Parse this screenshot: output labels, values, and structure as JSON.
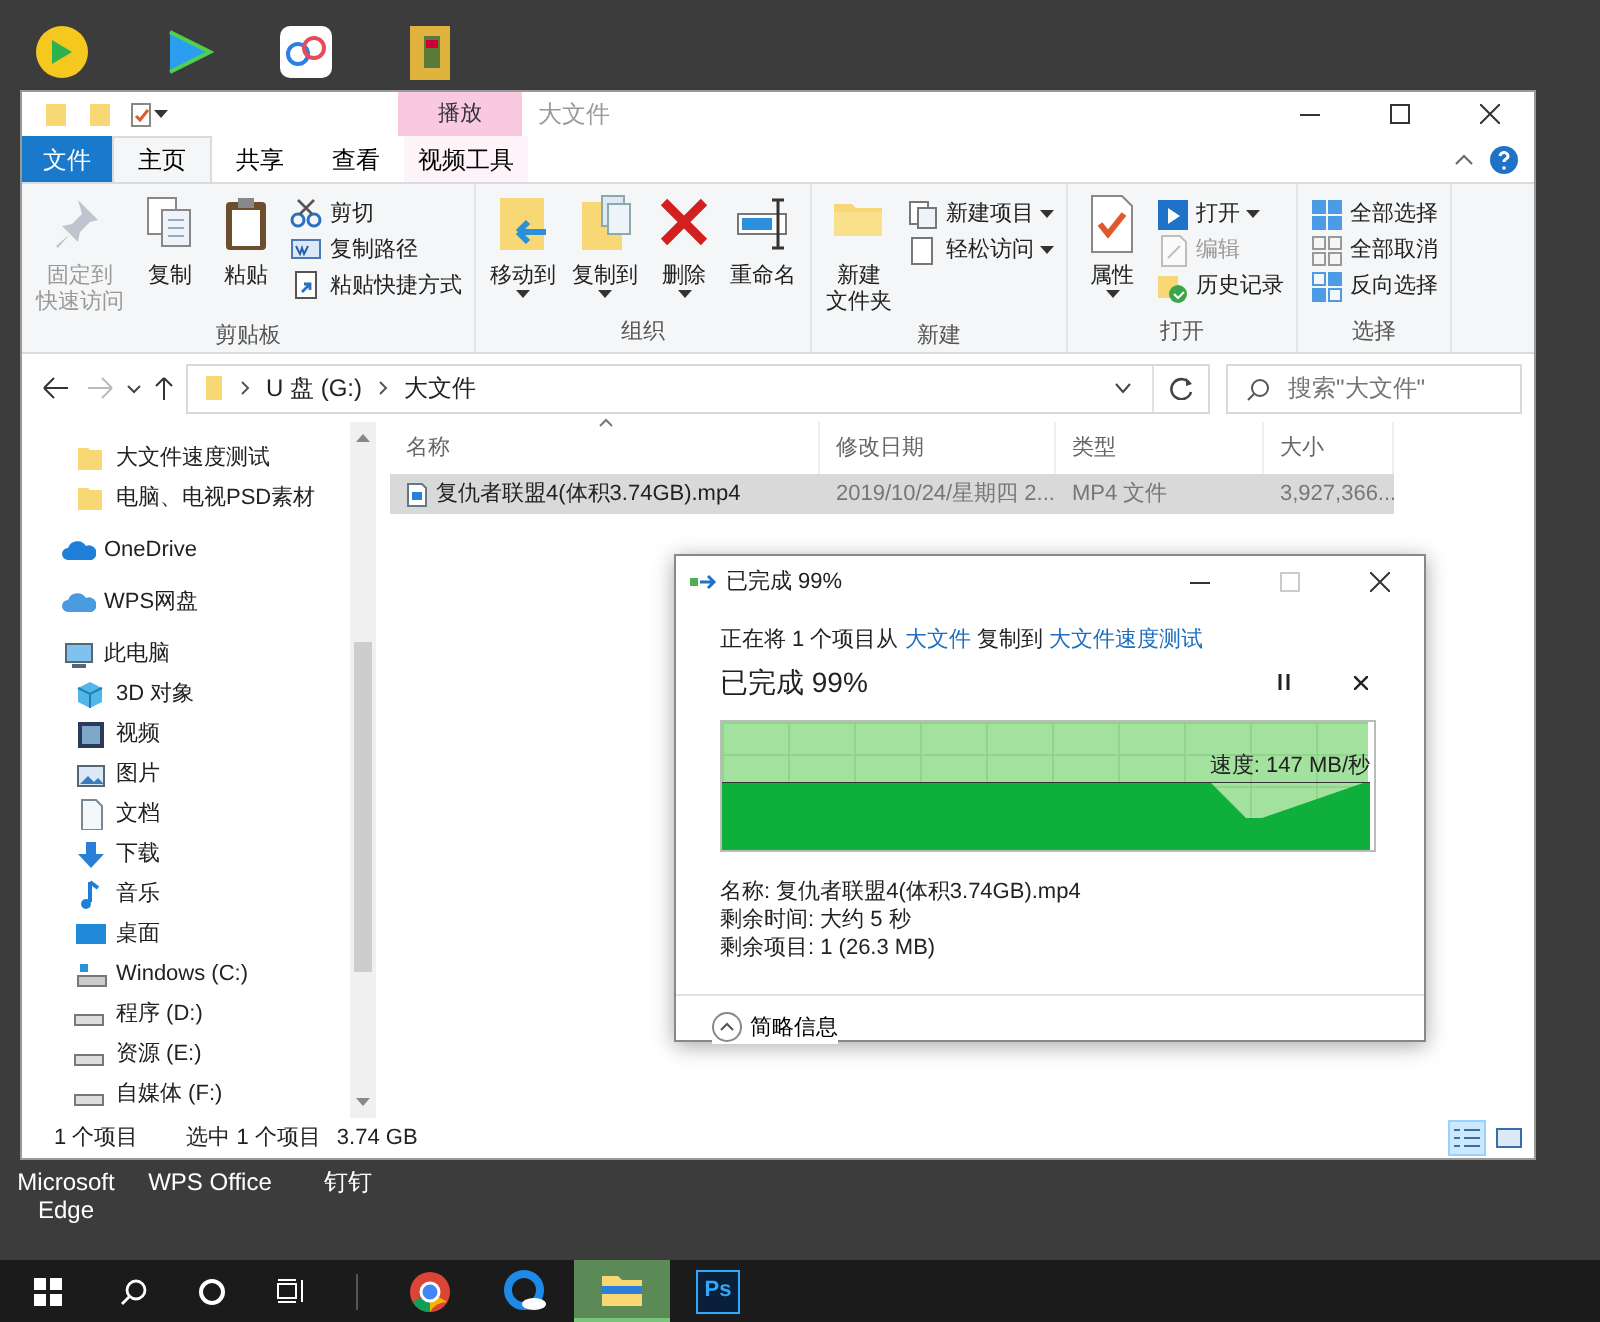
{
  "desktop_labels": [
    "Microsoft Edge",
    "WPS Office",
    "钉钉"
  ],
  "explorer": {
    "title": "大文件",
    "context_tab": "播放",
    "ribbon_tabs": [
      {
        "label": "文件",
        "kind": "file",
        "selected": false
      },
      {
        "label": "主页",
        "kind": "tab",
        "selected": true
      },
      {
        "label": "共享",
        "kind": "tab",
        "selected": false
      },
      {
        "label": "查看",
        "kind": "tab",
        "selected": false
      },
      {
        "label": "视频工具",
        "kind": "context",
        "selected": false
      }
    ],
    "ribbon_groups": [
      {
        "label": "剪贴板",
        "items": [
          {
            "kind": "large",
            "lines": [
              "固定到",
              "快速访问"
            ],
            "disabled": true,
            "dropdown": false
          },
          {
            "kind": "large",
            "lines": [
              "复制"
            ],
            "disabled": false,
            "dropdown": false
          },
          {
            "kind": "large",
            "lines": [
              "粘贴"
            ],
            "disabled": false,
            "dropdown": false
          },
          {
            "kind": "small",
            "lines": [
              "剪切"
            ],
            "disabled": false,
            "dropdown": false
          },
          {
            "kind": "small",
            "lines": [
              "复制路径"
            ],
            "disabled": false,
            "dropdown": false
          },
          {
            "kind": "small",
            "lines": [
              "粘贴快捷方式"
            ],
            "disabled": false,
            "dropdown": false
          }
        ]
      },
      {
        "label": "组织",
        "items": [
          {
            "kind": "large",
            "lines": [
              "移动到"
            ],
            "disabled": false,
            "dropdown": true
          },
          {
            "kind": "large",
            "lines": [
              "复制到"
            ],
            "disabled": false,
            "dropdown": true
          },
          {
            "kind": "large",
            "lines": [
              "删除"
            ],
            "disabled": false,
            "dropdown": true
          },
          {
            "kind": "large",
            "lines": [
              "重命名"
            ],
            "disabled": false,
            "dropdown": false
          }
        ]
      },
      {
        "label": "新建",
        "items": [
          {
            "kind": "large",
            "lines": [
              "新建",
              "文件夹"
            ],
            "disabled": false,
            "dropdown": false
          },
          {
            "kind": "small",
            "lines": [
              "新建项目"
            ],
            "disabled": false,
            "dropdown": true
          },
          {
            "kind": "small",
            "lines": [
              "轻松访问"
            ],
            "disabled": false,
            "dropdown": true
          }
        ]
      },
      {
        "label": "打开",
        "items": [
          {
            "kind": "large",
            "lines": [
              "属性"
            ],
            "disabled": false,
            "dropdown": true
          },
          {
            "kind": "small",
            "lines": [
              "打开"
            ],
            "disabled": false,
            "dropdown": true
          },
          {
            "kind": "small",
            "lines": [
              "编辑"
            ],
            "disabled": true,
            "dropdown": false
          },
          {
            "kind": "small",
            "lines": [
              "历史记录"
            ],
            "disabled": false,
            "dropdown": false
          }
        ]
      },
      {
        "label": "选择",
        "items": [
          {
            "kind": "small",
            "lines": [
              "全部选择"
            ],
            "disabled": false,
            "dropdown": false
          },
          {
            "kind": "small",
            "lines": [
              "全部取消"
            ],
            "disabled": false,
            "dropdown": false
          },
          {
            "kind": "small",
            "lines": [
              "反向选择"
            ],
            "disabled": false,
            "dropdown": false
          }
        ]
      }
    ],
    "address": {
      "path": [
        "U 盘 (G:)",
        "大文件"
      ]
    },
    "search": {
      "placeholder": "搜索\"大文件\""
    },
    "nav_pane": [
      {
        "label": "大文件速度测试",
        "kind": "folder"
      },
      {
        "label": "电脑、电视PSD素材",
        "kind": "folder"
      },
      {
        "label": "OneDrive",
        "kind": "onedrive"
      },
      {
        "label": "WPS网盘",
        "kind": "cloud"
      },
      {
        "label": "此电脑",
        "kind": "pc",
        "children": [
          {
            "label": "3D 对象",
            "kind": "cube"
          },
          {
            "label": "视频",
            "kind": "video"
          },
          {
            "label": "图片",
            "kind": "picture"
          },
          {
            "label": "文档",
            "kind": "document"
          },
          {
            "label": "下载",
            "kind": "download"
          },
          {
            "label": "音乐",
            "kind": "music"
          },
          {
            "label": "桌面",
            "kind": "desktop"
          },
          {
            "label": "Windows (C:)",
            "kind": "sysdrive"
          },
          {
            "label": "程序 (D:)",
            "kind": "drive"
          },
          {
            "label": "资源 (E:)",
            "kind": "drive"
          },
          {
            "label": "自媒体 (F:)",
            "kind": "drive"
          }
        ]
      }
    ],
    "columns": [
      "名称",
      "修改日期",
      "类型",
      "大小"
    ],
    "rows": [
      {
        "cells": [
          "复仇者联盟4(体积3.74GB).mp4",
          "2019/10/24/星期四 2...",
          "MP4 文件",
          "3,927,366..."
        ],
        "selected": true
      }
    ],
    "status_bar": {
      "item_count": "1 个项目",
      "selection": "选中 1 个项目",
      "size": "3.74 GB"
    },
    "view_buttons": [
      {
        "kind": "details",
        "selected": true
      },
      {
        "kind": "large_icons",
        "selected": false
      }
    ]
  },
  "copy_dialog": {
    "title": "已完成 99%",
    "description": {
      "prefix": "正在将 1 个项目从",
      "source": "大文件",
      "middle": "复制到",
      "destination": "大文件速度测试"
    },
    "heading": "已完成 99%",
    "level": 0.99,
    "speed": "速度: 147 MB/秒",
    "details": [
      "名称: 复仇者联盟4(体积3.74GB).mp4",
      "剩余时间: 大约 5 秒",
      "剩余项目: 1 (26.3 MB)"
    ],
    "footer": "简略信息"
  },
  "taskbar": {
    "apps": [
      {
        "kind": "chrome",
        "active": false
      },
      {
        "kind": "edge",
        "active": false
      },
      {
        "kind": "explorer",
        "active": true
      },
      {
        "kind": "photoshop",
        "glyph": "Ps",
        "active": false
      }
    ]
  }
}
